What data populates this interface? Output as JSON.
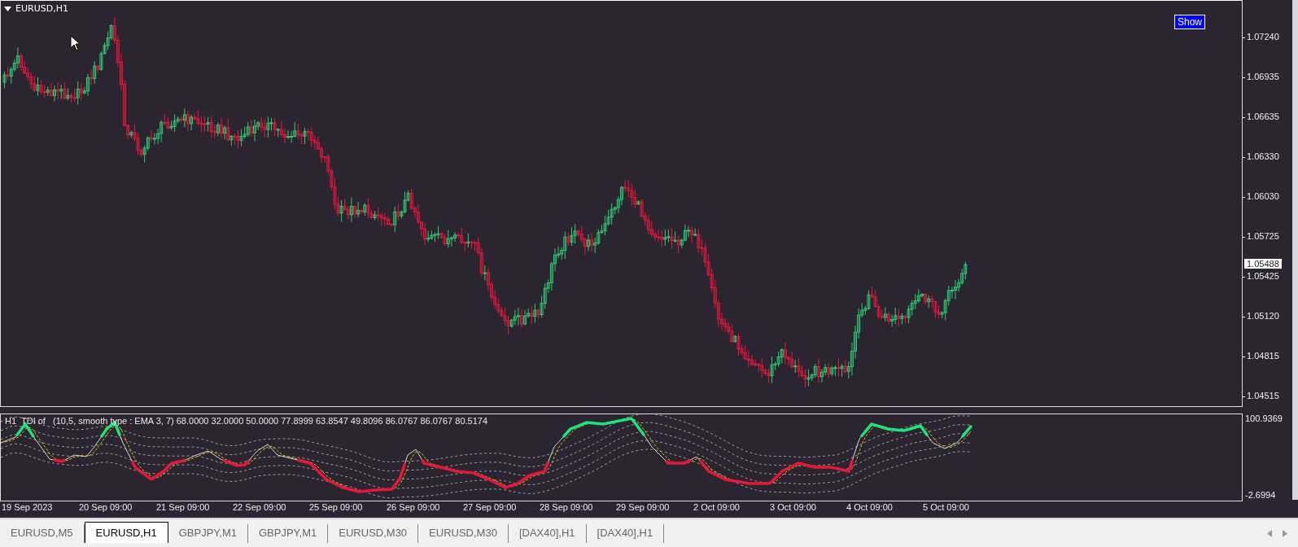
{
  "chart": {
    "title": "EURUSD,H1",
    "show_button": "Show",
    "price_ticks": [
      "1.07240",
      "1.06935",
      "1.06635",
      "1.06330",
      "1.06030",
      "1.05725",
      "1.05425",
      "1.05120",
      "1.04815",
      "1.04515"
    ],
    "current_price": "1.05488"
  },
  "indicator": {
    "title": "H1  TDI of   (10,5, smooth type : EMA 3, 7) 68.0000 32.0000 50.0000 77.8999 63.8547 49.8096 86.0767 86.0767 80.5174",
    "scale_max": "100.9369",
    "scale_min": "-2.6994"
  },
  "time_axis": [
    "19 Sep 2023",
    "20 Sep 09:00",
    "21 Sep 09:00",
    "22 Sep 09:00",
    "25 Sep 09:00",
    "26 Sep 09:00",
    "27 Sep 09:00",
    "28 Sep 09:00",
    "29 Sep 09:00",
    "2 Oct 09:00",
    "3 Oct 09:00",
    "4 Oct 09:00",
    "5 Oct 09:00"
  ],
  "tabs": [
    {
      "label": "EURUSD,M5",
      "selected": false
    },
    {
      "label": "EURUSD,H1",
      "selected": true
    },
    {
      "label": "GBPJPY,M1",
      "selected": false
    },
    {
      "label": "GBPJPY,M1",
      "selected": false
    },
    {
      "label": "EURUSD,M30",
      "selected": false
    },
    {
      "label": "EURUSD,M30",
      "selected": false
    },
    {
      "label": "[DAX40],H1",
      "selected": false
    },
    {
      "label": "[DAX40],H1",
      "selected": false
    }
  ]
}
